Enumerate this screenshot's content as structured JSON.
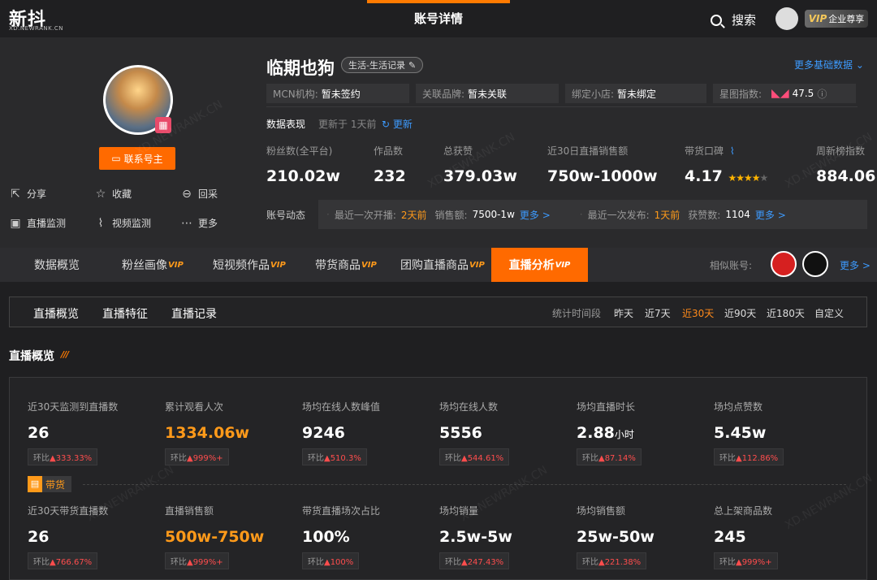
{
  "header": {
    "logo": "新抖",
    "logo_sub": "XD.NEWRANK.CN",
    "title": "账号详情",
    "search_label": "搜索",
    "vip_label": "VIP",
    "vip_text": "企业尊享"
  },
  "profile": {
    "name": "临期也狗",
    "category": "生活-生活记录",
    "more_basic": "更多基础数据",
    "contact_btn": "联系号主",
    "actions": {
      "share": "分享",
      "favorite": "收藏",
      "collect": "回采",
      "live_monitor": "直播监测",
      "video_monitor": "视频监测",
      "more": "更多"
    },
    "info": {
      "mcn_label": "MCN机构:",
      "mcn_value": "暂未签约",
      "brand_label": "关联品牌:",
      "brand_value": "暂未关联",
      "shop_label": "绑定小店:",
      "shop_value": "暂未绑定",
      "xingtu_label": "星图指数:",
      "xingtu_value": "47.5"
    },
    "perf_label": "数据表现",
    "perf_updated": "更新于 1天前",
    "perf_refresh": "更新",
    "stats": [
      {
        "label": "粉丝数(全平台)",
        "value": "210.02w"
      },
      {
        "label": "作品数",
        "value": "232"
      },
      {
        "label": "总获赞",
        "value": "379.03w"
      },
      {
        "label": "近30日直播销售额",
        "value": "750w-1000w"
      },
      {
        "label": "带货口碑",
        "value": "4.17"
      },
      {
        "label": "周新榜指数",
        "value": "884.06"
      }
    ],
    "dynamics": {
      "label": "账号动态",
      "live_label": "最近一次开播:",
      "live_time": "2天前",
      "sales_label": "销售额:",
      "sales_value": "7500-1w",
      "more1": "更多 >",
      "post_label": "最近一次发布:",
      "post_time": "1天前",
      "likes_label": "获赞数:",
      "likes_value": "1104",
      "more2": "更多 >"
    }
  },
  "tabs": [
    {
      "label": "数据概览",
      "vip": ""
    },
    {
      "label": "粉丝画像",
      "vip": "VIP"
    },
    {
      "label": "短视频作品",
      "vip": "VIP"
    },
    {
      "label": "带货商品",
      "vip": "VIP"
    },
    {
      "label": "团购直播商品",
      "vip": "VIP"
    },
    {
      "label": "直播分析",
      "vip": "VIP"
    }
  ],
  "similar": {
    "label": "相似账号:",
    "more": "更多 >"
  },
  "subtabs": [
    "直播概览",
    "直播特征",
    "直播记录"
  ],
  "period": {
    "label": "统计时间段",
    "options": [
      "昨天",
      "近7天",
      "近30天",
      "近90天",
      "近180天",
      "自定义"
    ],
    "active": "近30天"
  },
  "section_title": "直播概览",
  "metrics_row1": [
    {
      "label": "近30天监测到直播数",
      "value": "26",
      "unit": "",
      "chg_label": "环比",
      "chg": "▲333.33%"
    },
    {
      "label": "累计观看人次",
      "value": "1334.06w",
      "unit": "",
      "chg_label": "环比",
      "chg": "▲999%+"
    },
    {
      "label": "场均在线人数峰值",
      "value": "9246",
      "unit": "",
      "chg_label": "环比",
      "chg": "▲510.3%"
    },
    {
      "label": "场均在线人数",
      "value": "5556",
      "unit": "",
      "chg_label": "环比",
      "chg": "▲544.61%"
    },
    {
      "label": "场均直播时长",
      "value": "2.88",
      "unit": "小时",
      "chg_label": "环比",
      "chg": "▲87.14%"
    },
    {
      "label": "场均点赞数",
      "value": "5.45w",
      "unit": "",
      "chg_label": "环比",
      "chg": "▲112.86%"
    }
  ],
  "dh_tag": "带货",
  "metrics_row2": [
    {
      "label": "近30天带货直播数",
      "value": "26",
      "chg_label": "环比",
      "chg": "▲766.67%"
    },
    {
      "label": "直播销售额",
      "value": "500w-750w",
      "chg_label": "环比",
      "chg": "▲999%+"
    },
    {
      "label": "带货直播场次占比",
      "value": "100%",
      "chg_label": "环比",
      "chg": "▲100%"
    },
    {
      "label": "场均销量",
      "value": "2.5w-5w",
      "chg_label": "环比",
      "chg": "▲247.43%"
    },
    {
      "label": "场均销售额",
      "value": "25w-50w",
      "chg_label": "环比",
      "chg": "▲221.38%"
    },
    {
      "label": "总上架商品数",
      "value": "245",
      "chg_label": "环比",
      "chg": "▲999%+"
    }
  ],
  "colors": {
    "accent": "#ff6a00",
    "link": "#3d9bff",
    "rise": "#ff4d4d"
  },
  "watermark": "XD.NEWRANK.CN"
}
